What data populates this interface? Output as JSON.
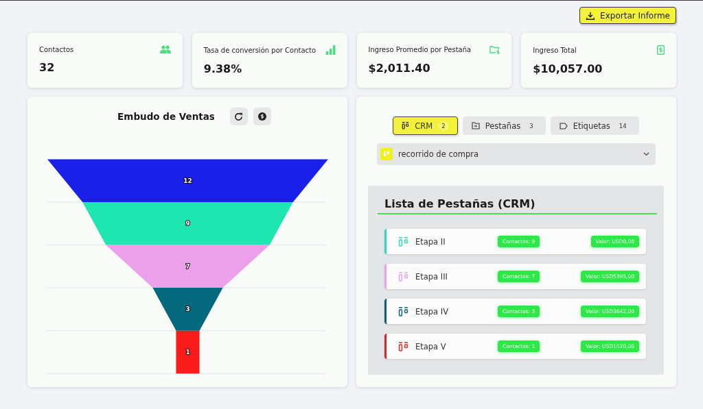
{
  "export_button": {
    "label": "Exportar Informe"
  },
  "stats": [
    {
      "label": "Contactos",
      "value": "32"
    },
    {
      "label": "Tasa de conversión por Contacto",
      "value": "9.38%"
    },
    {
      "label": "Ingreso Promedio por Pestaña",
      "value": "$2,011.40"
    },
    {
      "label": "Ingreso Total",
      "value": "$10,057.00"
    }
  ],
  "funnel": {
    "title": "Embudo de Ventas",
    "stages": [
      {
        "value": "12",
        "color": "#1b20e8"
      },
      {
        "value": "9",
        "color": "#1de6b0"
      },
      {
        "value": "7",
        "color": "#eca0ea"
      },
      {
        "value": "3",
        "color": "#05697d"
      },
      {
        "value": "1",
        "color": "#fb1b1b"
      }
    ]
  },
  "tabs": [
    {
      "label": "CRM",
      "count": "2",
      "selected": true
    },
    {
      "label": "Pestañas",
      "count": "3",
      "selected": false
    },
    {
      "label": "Etiquetas",
      "count": "14",
      "selected": false
    }
  ],
  "pipeline_select": {
    "value": "recorrido de compra"
  },
  "list": {
    "title": "Lista de Pestañas (CRM)",
    "rows": [
      {
        "name": "Etapa II",
        "contacts": "Contactos: 9",
        "amount": "Valor: USD0,00",
        "color": "#2ed8b8"
      },
      {
        "name": "Etapa III",
        "contacts": "Contactos: 7",
        "amount": "Valor: USD5395,00",
        "color": "#e6a3e6"
      },
      {
        "name": "Etapa IV",
        "contacts": "Contactos: 3",
        "amount": "Valor: USD3642,00",
        "color": "#0f5f70"
      },
      {
        "name": "Etapa V",
        "contacts": "Contactos: 1",
        "amount": "Valor: USD1020,00",
        "color": "#d92424"
      }
    ]
  }
}
